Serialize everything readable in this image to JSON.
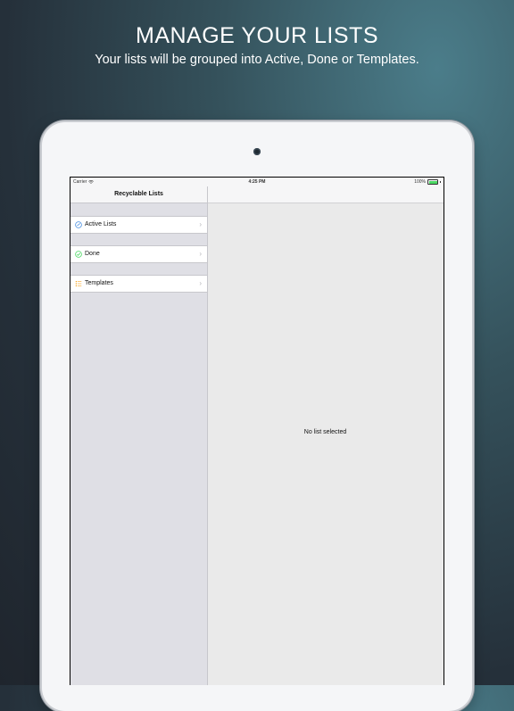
{
  "promo": {
    "headline": "MANAGE YOUR LISTS",
    "subline": "Your lists will be grouped into Active, Done or Templates."
  },
  "status_bar": {
    "carrier": "Carrier",
    "time": "4:25 PM",
    "battery": "100%"
  },
  "master": {
    "title": "Recyclable Lists",
    "items": [
      {
        "label": "Active Lists",
        "icon": "active-lists-icon",
        "color": "#4a90e2"
      },
      {
        "label": "Done",
        "icon": "checkmark-circle-icon",
        "color": "#4cd964"
      },
      {
        "label": "Templates",
        "icon": "template-list-icon",
        "color": "#f5a623"
      }
    ]
  },
  "detail": {
    "empty_message": "No list selected"
  },
  "colors": {
    "background_top": "#4b7d8a",
    "background_bottom": "#1f252d",
    "sidebar_background": "#dfdfe5",
    "detail_background": "#eaeaea"
  }
}
